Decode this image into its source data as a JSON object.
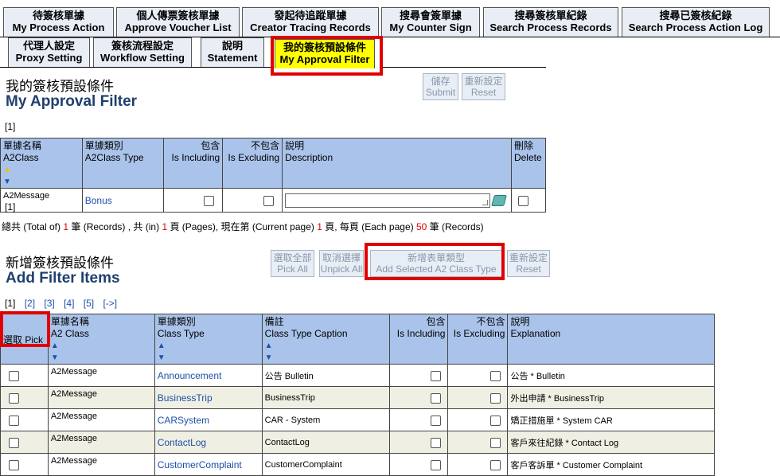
{
  "tabs_row1": [
    {
      "zh": "待簽核單據",
      "en": "My Process Action"
    },
    {
      "zh": "個人傳票簽核單據",
      "en": "Approve Voucher List"
    },
    {
      "zh": "發起待追蹤單據",
      "en": "Creator Tracing Records"
    },
    {
      "zh": "搜尋會簽單據",
      "en": "My Counter Sign"
    },
    {
      "zh": "搜尋簽核單紀錄",
      "en": "Search Process Records"
    },
    {
      "zh": "搜尋已簽核紀錄",
      "en": "Search Process Action Log"
    }
  ],
  "tabs_row2": [
    {
      "zh": "代理人設定",
      "en": "Proxy Setting"
    },
    {
      "zh": "簽核流程設定",
      "en": "Workflow Setting"
    },
    {
      "zh": "說明",
      "en": "Statement"
    },
    {
      "zh": "我的簽核預設條件",
      "en": "My Approval Filter"
    }
  ],
  "section1": {
    "title_zh": "我的簽核預設條件",
    "title_en": "My Approval Filter",
    "save_zh": "儲存",
    "save_en": "Submit",
    "reset_zh": "重新設定",
    "reset_en": "Reset",
    "pager_top": "[1]",
    "pager_bottom": "[1]",
    "headers": {
      "c1_zh": "單據名稱",
      "c1_en": "A2Class",
      "c2_zh": "單據類別",
      "c2_en": "A2Class Type",
      "c3_zh": "包含",
      "c3_en": "Is Including",
      "c4_zh": "不包含",
      "c4_en": "Is Excluding",
      "c5_zh": "說明",
      "c5_en": "Description",
      "c6_zh": "刪除",
      "c6_en": "Delete"
    },
    "row": {
      "a2class": "A2Message",
      "type": "Bonus"
    },
    "summary": {
      "p1": "總共 (Total of)",
      "total": "1",
      "p2": "筆 (Records) , 共 (in)",
      "pages": "1",
      "p3": "頁 (Pages), 現在第 (Current page)",
      "current": "1",
      "p4": "頁, 每頁 (Each page)",
      "each": "50",
      "p5": "筆 (Records)"
    }
  },
  "section2": {
    "title_zh": "新增簽核預設條件",
    "title_en": "Add Filter Items",
    "select_all_zh": "選取全部",
    "select_all_en": "Pick All",
    "unselect_zh": "取消選擇",
    "unselect_en": "Unpick All",
    "add_zh": "新增表單類型",
    "add_en": "Add Selected A2 Class Type",
    "reset_zh": "重新設定",
    "reset_en": "Reset",
    "pager": {
      "current": "[1]",
      "p2": "[2]",
      "p3": "[3]",
      "p4": "[4]",
      "p5": "[5]",
      "next": "[->]"
    },
    "headers": {
      "c1": "選取 Pick",
      "c2_zh": "單據名稱",
      "c2_en": "A2 Class",
      "c3_zh": "單據類別",
      "c3_en": "Class Type",
      "c4_zh": "備註",
      "c4_en": "Class Type Caption",
      "c5_zh": "包含",
      "c5_en": "Is Including",
      "c6_zh": "不包含",
      "c6_en": "Is Excluding",
      "c7_zh": "說明",
      "c7_en": "Explanation"
    },
    "rows": [
      {
        "a2": "A2Message",
        "type": "Announcement",
        "caption": "公告 Bulletin",
        "expl": "公告 * Bulletin"
      },
      {
        "a2": "A2Message",
        "type": "BusinessTrip",
        "caption": "BusinessTrip",
        "expl": "外出申請 * BusinessTrip"
      },
      {
        "a2": "A2Message",
        "type": "CARSystem",
        "caption": "CAR - System",
        "expl": "矯正措施單 * System CAR"
      },
      {
        "a2": "A2Message",
        "type": "ContactLog",
        "caption": "ContactLog",
        "expl": "客戶來往紀錄 * Contact Log"
      },
      {
        "a2": "A2Message",
        "type": "CustomerComplaint",
        "caption": "CustomerComplaint",
        "expl": "客戶客訴單 * Customer Complaint"
      }
    ]
  },
  "colors": {
    "accent_red": "#e00000",
    "header_blue": "#aac3ea",
    "link_blue": "#1d4fa8",
    "active_tab": "#ffff00"
  }
}
